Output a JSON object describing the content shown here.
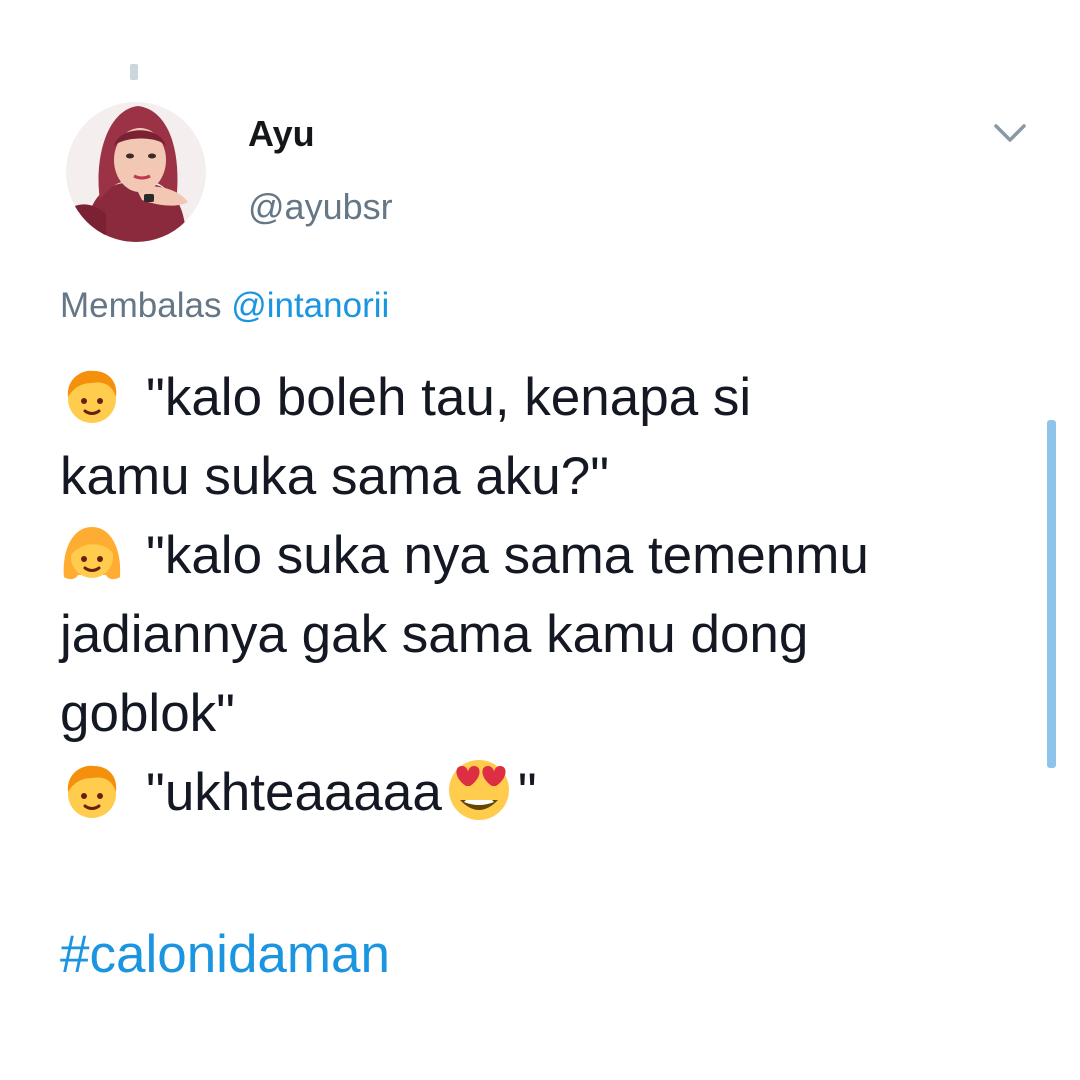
{
  "tweet": {
    "author": {
      "name": "Ayu",
      "handle": "@ayubsr",
      "avatar_icon": "avatar-hijab-photo"
    },
    "reply": {
      "prefix": "Membalas",
      "handle": "@intanorii"
    },
    "lines": [
      {
        "emoji": "boy-emoji",
        "text": "\"kalo boleh tau, kenapa si"
      },
      {
        "text": "kamu suka sama aku?\""
      },
      {
        "emoji": "girl-emoji",
        "text": "\"kalo suka nya sama temenmu"
      },
      {
        "text": "jadiannya gak sama kamu dong"
      },
      {
        "text": "goblok\""
      },
      {
        "emoji": "boy-emoji",
        "text_before": "\"ukhteaaaaa",
        "inline_emoji": "heart-eyes-emoji",
        "text_after": "\""
      }
    ],
    "hashtag": "#calonidaman"
  },
  "colors": {
    "text": "#141823",
    "muted": "#657786",
    "link": "#1b95e0",
    "scrollbar": "#8fc4ea"
  }
}
